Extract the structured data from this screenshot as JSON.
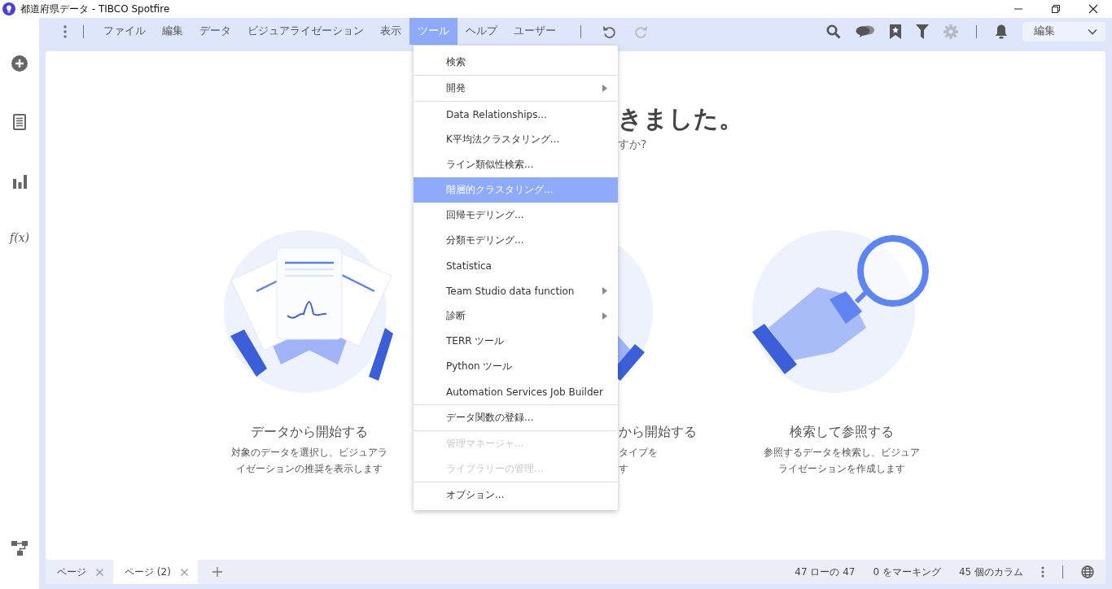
{
  "window": {
    "title": "都道府県データ - TIBCO Spotfire"
  },
  "sidebar": {
    "function_label": "f(x)"
  },
  "menubar": {
    "items": [
      {
        "label": "ファイル",
        "selected": false
      },
      {
        "label": "編集",
        "selected": false
      },
      {
        "label": "データ",
        "selected": false
      },
      {
        "label": "ビジュアライゼーション",
        "selected": false
      },
      {
        "label": "表示",
        "selected": false
      },
      {
        "label": "ツール",
        "selected": true
      },
      {
        "label": "ヘルプ",
        "selected": false
      },
      {
        "label": "ユーザー",
        "selected": false
      }
    ]
  },
  "toolbar": {
    "history": [
      {
        "kind": "undo",
        "disabled": false
      },
      {
        "kind": "redo",
        "disabled": true
      }
    ],
    "icons": [
      {
        "kind": "search",
        "disabled": false
      },
      {
        "kind": "comments",
        "disabled": false
      },
      {
        "kind": "bookmark",
        "disabled": false
      },
      {
        "kind": "filter",
        "disabled": false
      },
      {
        "kind": "settings",
        "disabled": true
      }
    ],
    "notifications": {
      "kind": "bell",
      "disabled": false
    },
    "mode": "編集"
  },
  "tools_menu": {
    "groups": [
      [
        {
          "label": "検索",
          "submenu": false,
          "disabled": false,
          "selected": false
        }
      ],
      [
        {
          "label": "開発",
          "submenu": true,
          "disabled": false,
          "selected": false
        }
      ],
      [
        {
          "label": "Data Relationships...",
          "submenu": false,
          "disabled": false,
          "selected": false
        },
        {
          "label": "K平均法クラスタリング...",
          "submenu": false,
          "disabled": false,
          "selected": false
        },
        {
          "label": "ライン類似性検索...",
          "submenu": false,
          "disabled": false,
          "selected": false
        },
        {
          "label": "階層的クラスタリング...",
          "submenu": false,
          "disabled": false,
          "selected": true
        },
        {
          "label": "回帰モデリング...",
          "submenu": false,
          "disabled": false,
          "selected": false
        },
        {
          "label": "分類モデリング...",
          "submenu": false,
          "disabled": false,
          "selected": false
        },
        {
          "label": "Statistica",
          "submenu": false,
          "disabled": false,
          "selected": false
        },
        {
          "label": "Team Studio data function",
          "submenu": true,
          "disabled": false,
          "selected": false
        },
        {
          "label": "診断",
          "submenu": true,
          "disabled": false,
          "selected": false
        },
        {
          "label": "TERR ツール",
          "submenu": false,
          "disabled": false,
          "selected": false
        },
        {
          "label": "Python ツール",
          "submenu": false,
          "disabled": false,
          "selected": false
        },
        {
          "label": "Automation Services Job Builder",
          "submenu": false,
          "disabled": false,
          "selected": false
        }
      ],
      [
        {
          "label": "データ関数の登録...",
          "submenu": false,
          "disabled": false,
          "selected": false
        }
      ],
      [
        {
          "label": "管理マネージャ...",
          "submenu": false,
          "disabled": true,
          "selected": false
        },
        {
          "label": "ライブラリーの管理...",
          "submenu": false,
          "disabled": true,
          "selected": false
        }
      ],
      [
        {
          "label": "オプション...",
          "submenu": false,
          "disabled": false,
          "selected": false
        }
      ]
    ]
  },
  "welcome": {
    "heading": "きました。",
    "subheading": "すか?",
    "cards": [
      {
        "kind": "data",
        "title": "データから開始する",
        "lines": [
          "対象のデータを選択し、ビジュアラ",
          "イゼーションの推奨を表示します"
        ]
      },
      {
        "kind": "template",
        "title": "から開始する",
        "lines": [
          "タイプを",
          "す"
        ]
      },
      {
        "kind": "search",
        "title": "検索して参照する",
        "lines": [
          "参照するデータを検索し、ビジュア",
          "ライゼーションを作成します"
        ]
      }
    ]
  },
  "pages": [
    {
      "label": "ページ",
      "selected": false
    },
    {
      "label": "ページ (2)",
      "selected": true
    }
  ],
  "status_bar": {
    "rows": "47 ローの 47",
    "marked": "0 をマーキング",
    "columns": "45 個のカラム"
  }
}
